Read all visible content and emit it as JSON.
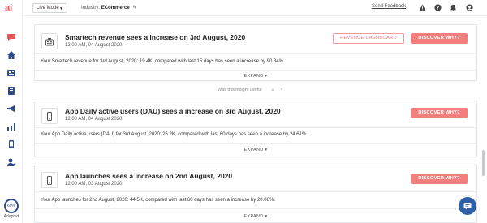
{
  "brand": {
    "logo_text": "ai",
    "accent": "#e8585b"
  },
  "sidebar": {
    "icons": [
      "chat-icon",
      "home-icon",
      "news-icon",
      "document-icon",
      "megaphone-icon",
      "chart-icon",
      "mobile-report-icon",
      "user-settings-icon"
    ],
    "adoption": {
      "value": "69%",
      "label": "Adapted"
    }
  },
  "topbar": {
    "mode": "Live Mode",
    "industry_label": "Industry:",
    "industry_value": "ECommerce",
    "feedback": "Send Feedback",
    "icons": [
      "alert-icon",
      "help-icon",
      "bell-icon",
      "account-icon"
    ]
  },
  "insights": [
    {
      "title": "Smartech revenue sees a increase on 3rd August, 2020",
      "time": "12:00 AM, 04 August 2020",
      "description": "Your Smartech revenue for 3rd August, 2020: 19.4K, compared with last 15 days has seen a increase by 90.34%.",
      "expand": "EXPAND",
      "secondary_button": "REVENUE DASHBOARD",
      "primary_button": "DISCOVER WHY?",
      "icon": "revenue-icon"
    },
    {
      "title": "App Daily active users (DAU) sees a increase on 3rd August, 2020",
      "time": "12:00 AM, 04 August 2020",
      "description": "Your App Daily active users (DAU) for 3rd August, 2020: 26.2K, compared with last 60 days has seen a increase by 24.61%.",
      "expand": "EXPAND",
      "primary_button": "DISCOVER WHY?",
      "icon": "mobile-icon"
    },
    {
      "title": "App launches sees a increase on 2nd August, 2020",
      "time": "12:00 AM, 03 August 2020",
      "description": "Your App launches for 2nd August, 2020: 44.5K, compared with last 60 days has seen a increase by 20.08%.",
      "expand": "EXPAND",
      "primary_button": "DISCOVER WHY?",
      "icon": "mobile-icon"
    }
  ],
  "feedback_prompt": "Was this insight useful",
  "colors": {
    "button": "#f27e7e",
    "chat": "#2f5fa6",
    "adoption": "#2f4b8c"
  }
}
